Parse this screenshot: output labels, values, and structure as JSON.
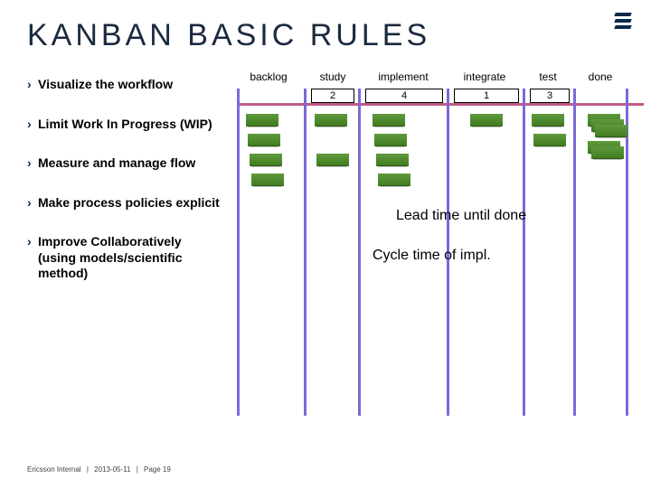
{
  "title": "Kanban Basic Rules",
  "rules": [
    "Visualize the workflow",
    "Limit Work In Progress (WIP)",
    "Measure and manage flow",
    "Make process policies explicit",
    "Improve Collaboratively (using models/scientific method)"
  ],
  "columns": [
    {
      "name": "backlog",
      "wip": null
    },
    {
      "name": "study",
      "wip": "2"
    },
    {
      "name": "implement",
      "wip": "4"
    },
    {
      "name": "integrate",
      "wip": "1"
    },
    {
      "name": "test",
      "wip": "3"
    },
    {
      "name": "done",
      "wip": null
    }
  ],
  "notes": {
    "lead": "Lead time until done",
    "cycle": "Cycle time of impl."
  },
  "footer": {
    "org": "Ericsson Internal",
    "date": "2013-05-11",
    "page": "Page 19"
  }
}
